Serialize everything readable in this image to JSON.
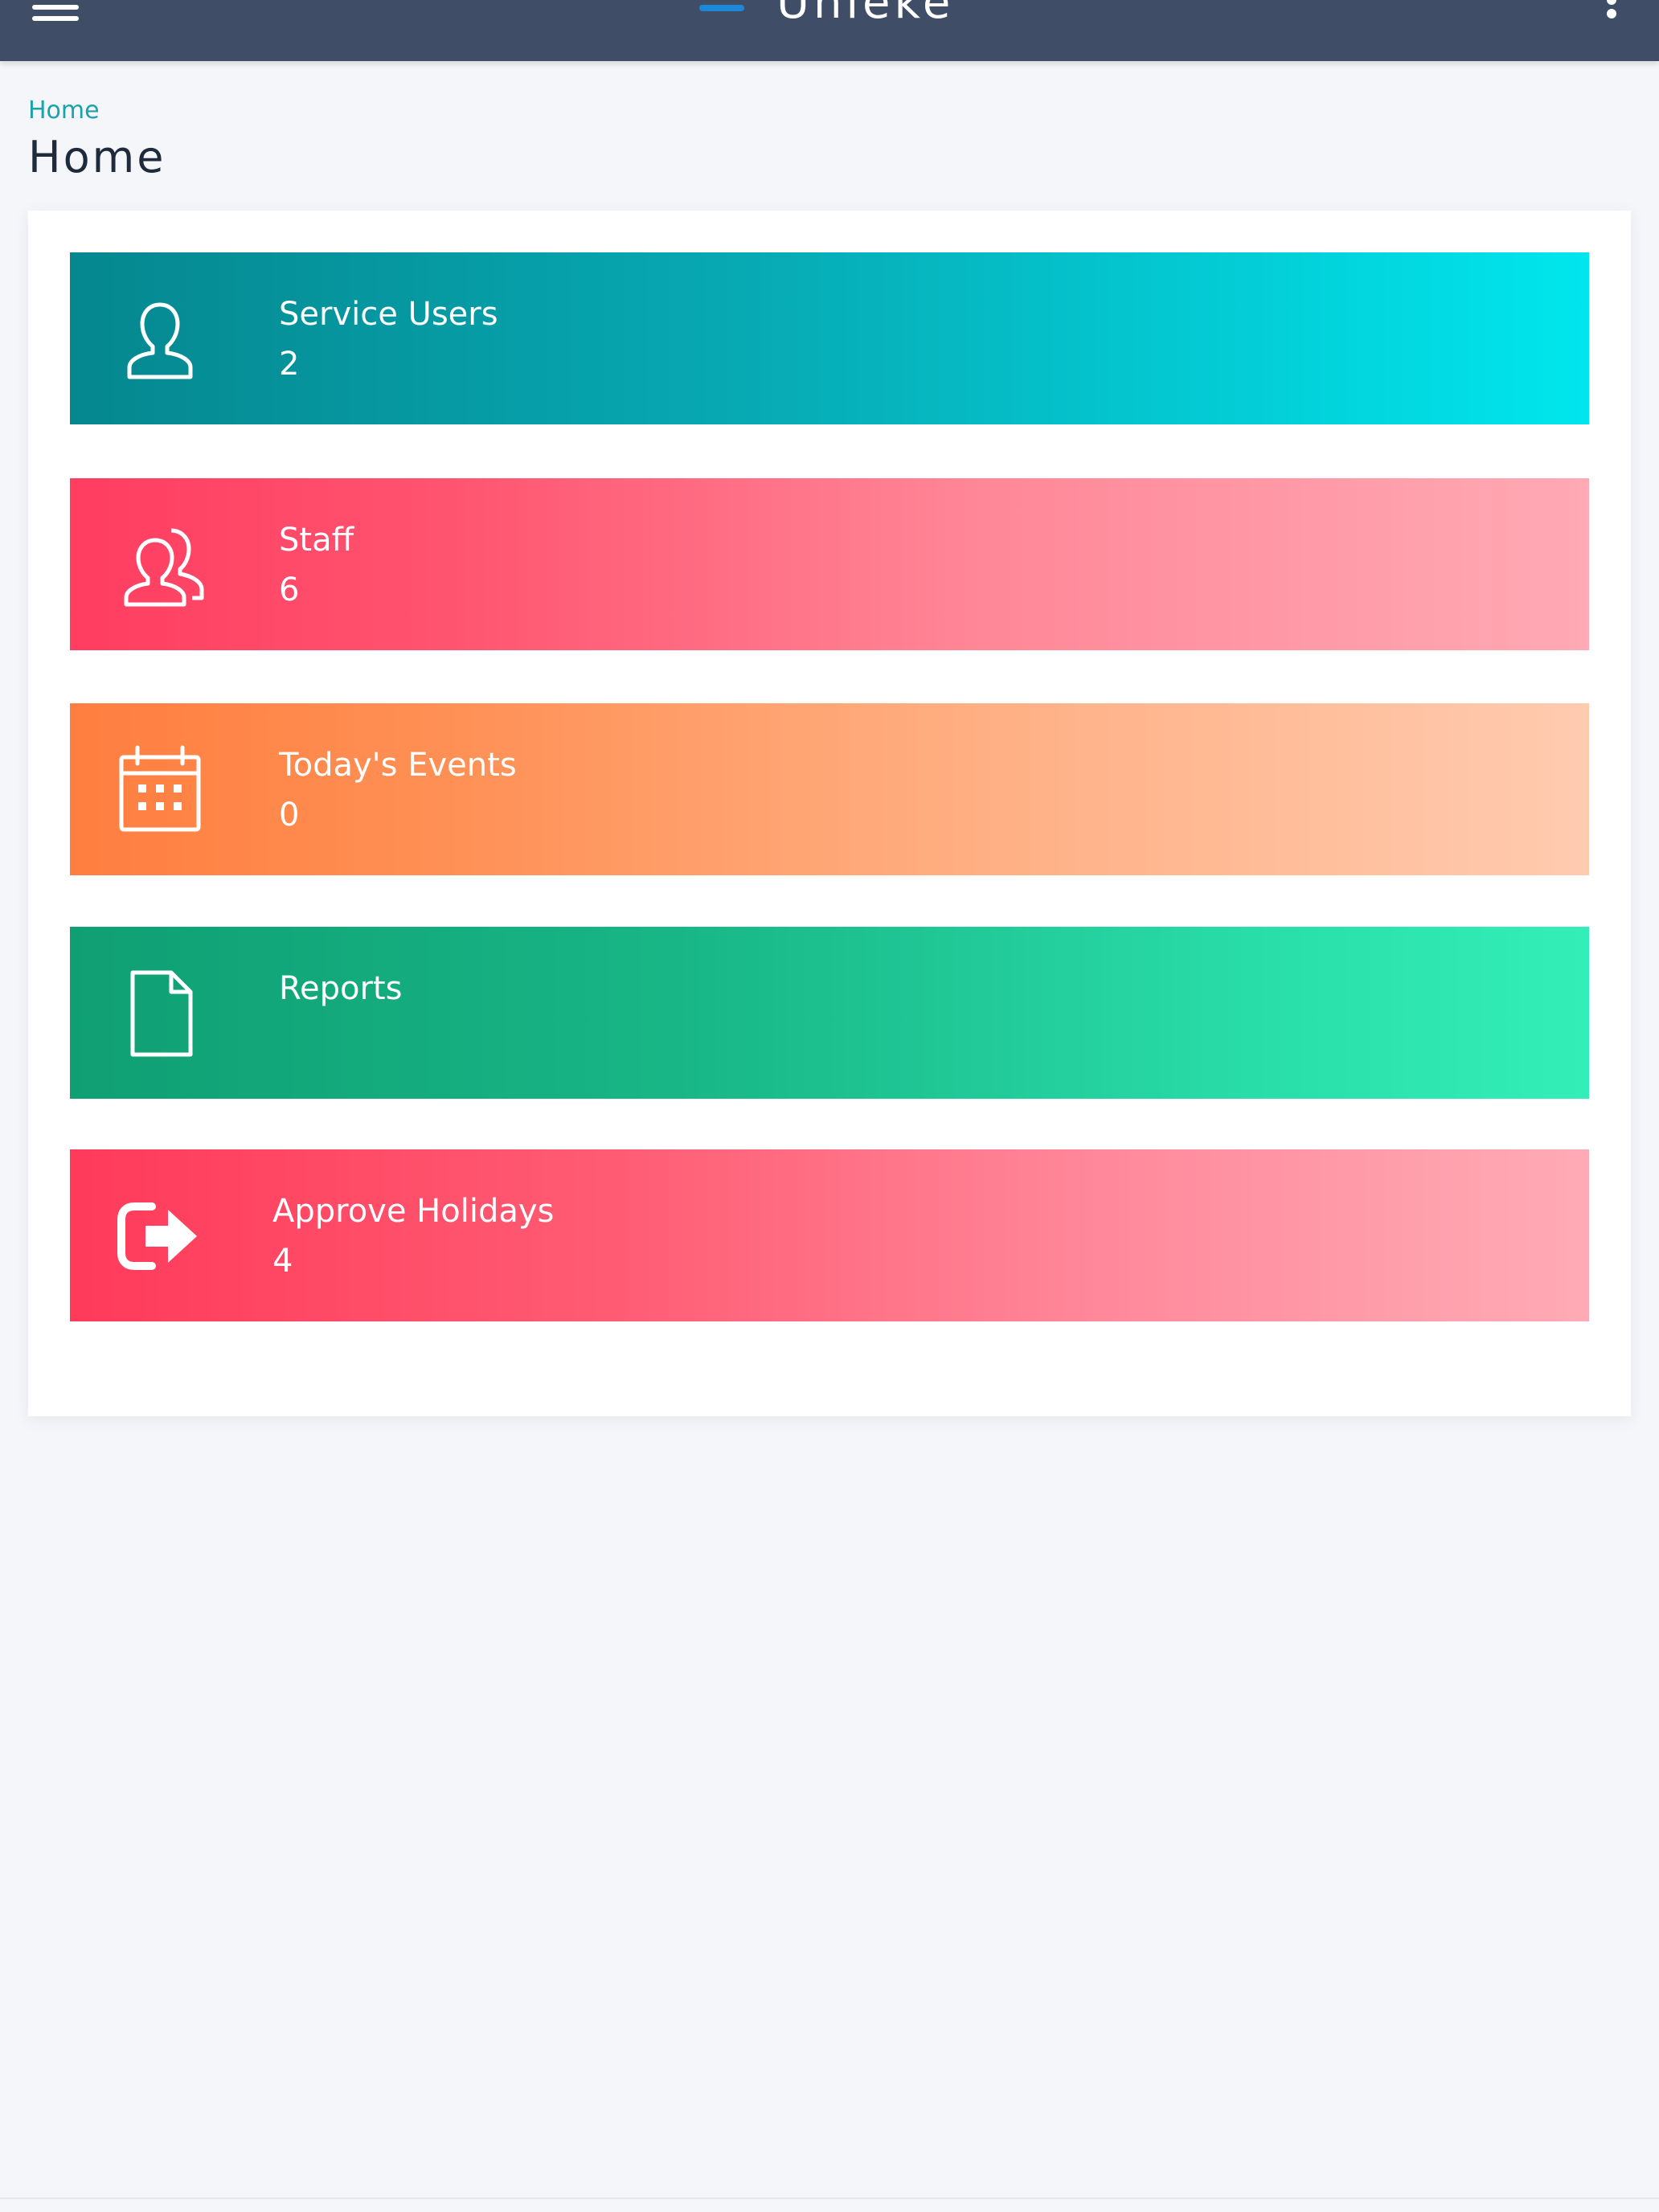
{
  "topbar": {
    "brand": "Unleke",
    "menu_icon": "hamburger-menu-icon",
    "more_icon": "more-vertical-icon",
    "background_color": "#3f4d67"
  },
  "breadcrumb": {
    "items": [
      "Home"
    ]
  },
  "page": {
    "title": "Home"
  },
  "tiles": [
    {
      "label": "Service Users",
      "count": "2",
      "icon": "user-icon"
    },
    {
      "label": "Staff",
      "count": "6",
      "icon": "users-icon"
    },
    {
      "label": "Today's Events",
      "count": "0",
      "icon": "calendar-icon"
    },
    {
      "label": "Reports",
      "count": "",
      "icon": "document-icon"
    },
    {
      "label": "Approve Holidays",
      "count": "4",
      "icon": "sign-out-icon"
    }
  ],
  "colors": {
    "accent": "#1ba3ad",
    "page_background": "#f5f6fa",
    "service_users": "#05878f",
    "staff": "#ff3d61",
    "events": "#ff7e3f",
    "reports": "#0f9f73",
    "holidays": "#ff3a5a"
  }
}
